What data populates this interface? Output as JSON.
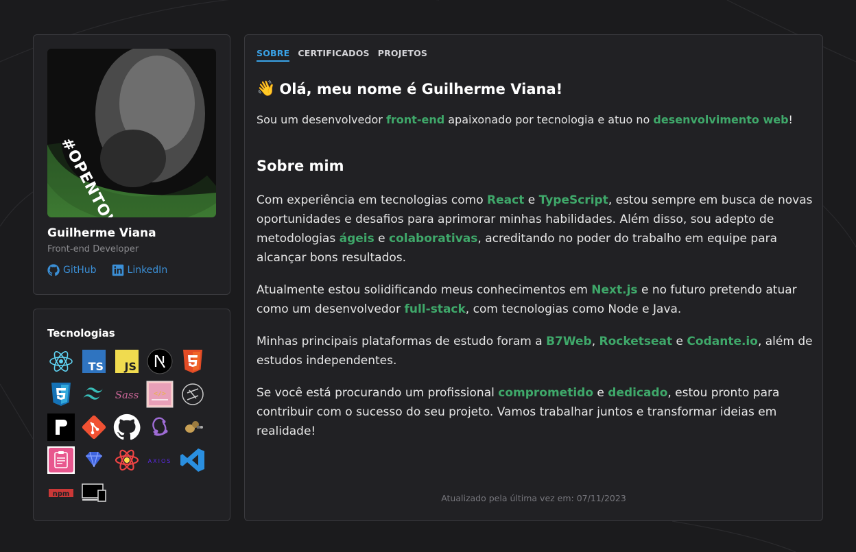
{
  "profile": {
    "photo_tag": "#OPENTOWORK",
    "name": "Guilherme Viana",
    "role": "Front-end Developer",
    "links": [
      {
        "label": "GitHub",
        "icon": "github-icon"
      },
      {
        "label": "LinkedIn",
        "icon": "linkedin-icon"
      }
    ]
  },
  "technologies": {
    "title": "Tecnologias",
    "items": [
      "react-icon",
      "typescript-icon",
      "javascript-icon",
      "nextjs-icon",
      "html5-icon",
      "css3-icon",
      "tailwind-icon",
      "sass-icon",
      "styled-components-icon",
      "stitches-icon",
      "radix-icon",
      "git-icon",
      "github-icon",
      "redux-icon",
      "jest-icon",
      "clipboard-icon",
      "sanity-icon",
      "react-query-icon",
      "axios-icon",
      "vscode-icon",
      "npm-icon",
      "vercel-icon"
    ]
  },
  "tabs": [
    {
      "label": "SOBRE",
      "active": true
    },
    {
      "label": "CERTIFICADOS",
      "active": false
    },
    {
      "label": "PROJETOS",
      "active": false
    }
  ],
  "about": {
    "greeting_emoji": "👋",
    "greeting": "Olá, meu nome é Guilherme Viana!",
    "lead": {
      "t1": "Sou um desenvolvedor ",
      "h1": "front-end",
      "t2": " apaixonado por tecnologia e atuo no ",
      "h2": "desenvolvimento web",
      "t3": "!"
    },
    "section_title": "Sobre mim",
    "p1": {
      "t1": "Com experiência em tecnologias como ",
      "h1": "React",
      "t2": " e ",
      "h2": "TypeScript",
      "t3": ", estou sempre em busca de novas oportunidades e desafios para aprimorar minhas habilidades. Além disso, sou adepto de metodologias ",
      "h3": "ágeis",
      "t4": " e ",
      "h4": "colaborativas",
      "t5": ", acreditando no poder do trabalho em equipe para alcançar bons resultados."
    },
    "p2": {
      "t1": "Atualmente estou solidificando meus conhecimentos em ",
      "h1": "Next.js",
      "t2": " e no futuro pretendo atuar como um desenvolvedor ",
      "h2": "full-stack",
      "t3": ", com tecnologias como Node e Java."
    },
    "p3": {
      "t1": "Minhas principais plataformas de estudo foram a ",
      "h1": "B7Web",
      "t2": ", ",
      "h2": "Rocketseat",
      "t3": " e ",
      "h3": "Codante.io",
      "t4": ", além de estudos independentes."
    },
    "p4": {
      "t1": "Se você está procurando um profissional ",
      "h1": "comprometido",
      "t2": " e ",
      "h2": "dedicado",
      "t3": ", estou pronto para contribuir com o sucesso do seu projeto. Vamos trabalhar juntos e transformar ideias em realidade!"
    },
    "footer": "Atualizado pela última vez em: 07/11/2023"
  },
  "colors": {
    "background": "#1b1b1d",
    "card": "#212124",
    "accent": "#3aa3e8",
    "highlight": "#3fa86a",
    "link": "#3b8fd6"
  }
}
